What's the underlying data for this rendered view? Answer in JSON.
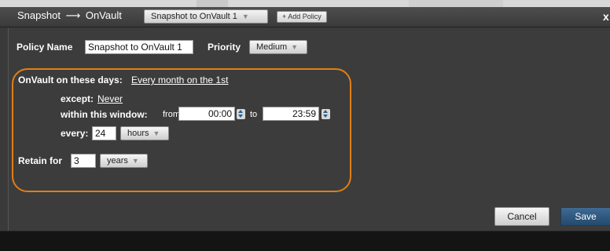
{
  "header": {
    "breadcrumb_from": "Snapshot",
    "breadcrumb_arrow": "⟶",
    "breadcrumb_to": "OnVault",
    "policy_select": "Snapshot to OnVault 1",
    "add_policy": "+ Add Policy",
    "close": "x"
  },
  "form": {
    "policy_name_label": "Policy Name",
    "policy_name_value": "Snapshot to OnVault 1",
    "priority_label": "Priority",
    "priority_value": "Medium",
    "days_label": "OnVault on these days:",
    "days_value": "Every month on the 1st",
    "except_label": "except:",
    "except_value": "Never",
    "window_label": "within this window:",
    "from_label": "from",
    "from_value": "00:00",
    "to_label": "to",
    "to_value": "23:59",
    "every_label": "every:",
    "every_value": "24",
    "every_unit": "hours",
    "retain_label": "Retain for",
    "retain_value": "3",
    "retain_unit": "years"
  },
  "buttons": {
    "cancel": "Cancel",
    "save": "Save"
  },
  "colors": {
    "highlight": "#e07f16",
    "save_button": "#2f5880"
  }
}
